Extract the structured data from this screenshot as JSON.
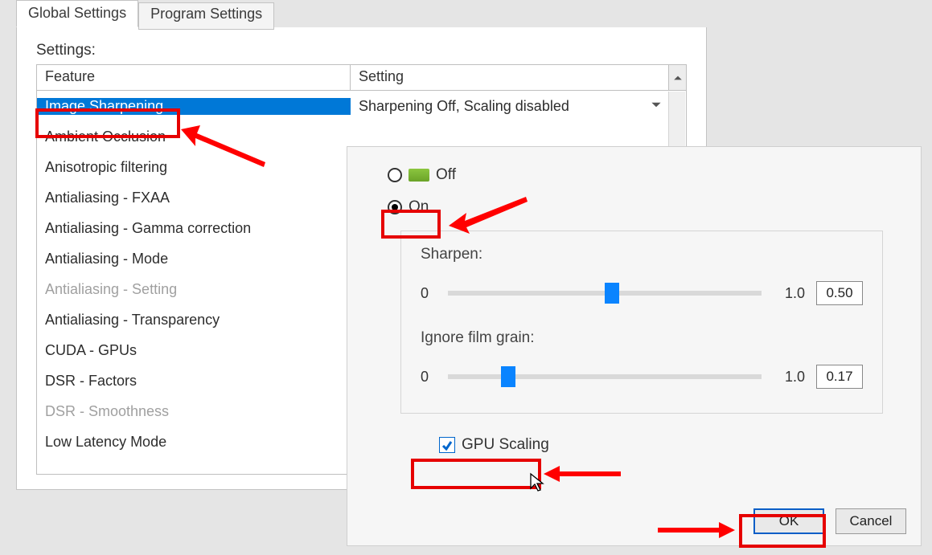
{
  "tabs": {
    "global": "Global Settings",
    "program": "Program Settings"
  },
  "settings_label": "Settings:",
  "table": {
    "header_feature": "Feature",
    "header_setting": "Setting",
    "selected_setting": "Sharpening Off, Scaling disabled",
    "rows": [
      "Image Sharpening",
      "Ambient Occlusion",
      "Anisotropic filtering",
      "Antialiasing - FXAA",
      "Antialiasing - Gamma correction",
      "Antialiasing - Mode",
      "Antialiasing - Setting",
      "Antialiasing - Transparency",
      "CUDA - GPUs",
      "DSR - Factors",
      "DSR - Smoothness",
      "Low Latency Mode"
    ]
  },
  "popup": {
    "off_label": "Off",
    "on_label": "On",
    "sharpen_label": "Sharpen:",
    "sharpen_min": "0",
    "sharpen_max": "1.0",
    "sharpen_val": "0.50",
    "grain_label": "Ignore film grain:",
    "grain_min": "0",
    "grain_max": "1.0",
    "grain_val": "0.17",
    "gpu_scaling": "GPU Scaling",
    "ok": "OK",
    "cancel": "Cancel"
  }
}
